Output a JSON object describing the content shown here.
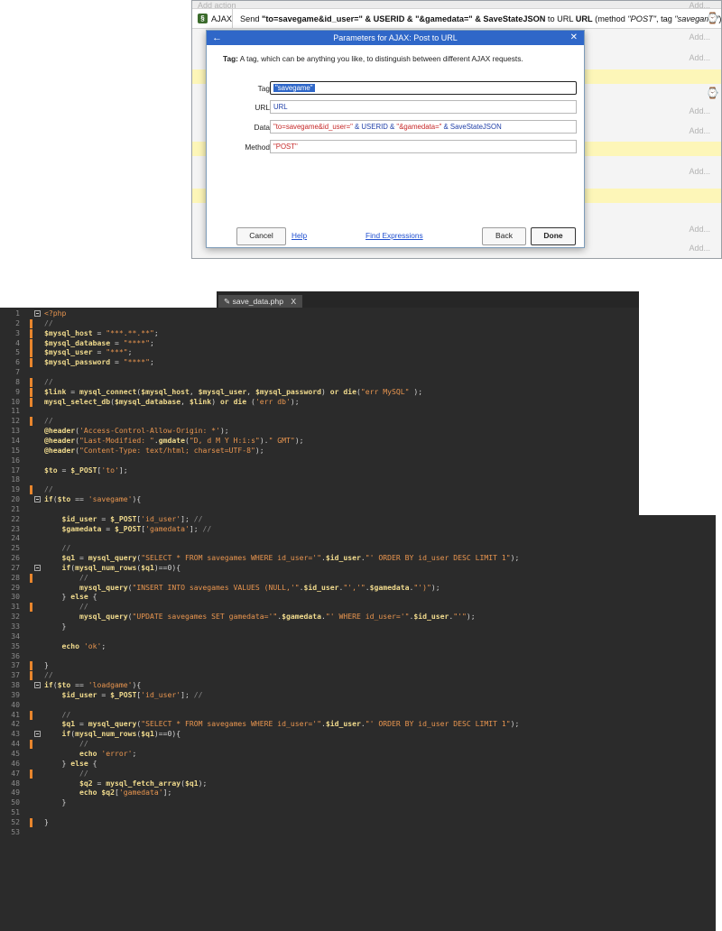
{
  "event_sheet": {
    "faded_top_label": "Add action",
    "add_label": "Add...",
    "ajax_row": {
      "object": "AJAX",
      "parts": [
        {
          "t": "Send ",
          "s": "n"
        },
        {
          "t": "\"to=savegame&id_user=\" & USERID & \"&gamedata=\" & SaveStateJSON",
          "s": "b"
        },
        {
          "t": " to URL ",
          "s": "n"
        },
        {
          "t": "URL",
          "s": "b"
        },
        {
          "t": " (method ",
          "s": "n"
        },
        {
          "t": "\"POST\"",
          "s": "i"
        },
        {
          "t": ", tag ",
          "s": "n"
        },
        {
          "t": "\"savegame\"",
          "s": "i"
        },
        {
          "t": ")",
          "s": "n"
        }
      ]
    }
  },
  "dialog": {
    "title": "Parameters for AJAX: Post to URL",
    "description_bold": "Tag:",
    "description": " A tag, which can be anything you like, to distinguish between different AJAX requests.",
    "fields": [
      {
        "label": "Tag",
        "value": "\"savegame\"",
        "style": "sel"
      },
      {
        "label": "URL",
        "value": "URL",
        "style": "blue"
      },
      {
        "label": "Data",
        "value": "",
        "style": "mixed",
        "parts": [
          {
            "t": "\"to=savegame&id_user=\"",
            "c": "red"
          },
          {
            "t": " & USERID & ",
            "c": "blue"
          },
          {
            "t": "\"&gamedata=\"",
            "c": "red"
          },
          {
            "t": " & SaveStateJSON",
            "c": "blue"
          }
        ]
      },
      {
        "label": "Method",
        "value": "\"POST\"",
        "style": "red"
      }
    ],
    "buttons": {
      "cancel": "Cancel",
      "help": "Help",
      "find": "Find Expressions",
      "back": "Back",
      "done": "Done"
    }
  },
  "editor": {
    "tab_label": "save_data.php",
    "tab_close": "X",
    "lines": [
      {
        "n": "1",
        "fold": true,
        "mark": false,
        "tokens": [
          [
            "<?php",
            "php"
          ]
        ]
      },
      {
        "n": "2",
        "mark": true,
        "tokens": [
          [
            "    //",
            "cmt"
          ]
        ]
      },
      {
        "n": "3",
        "mark": true,
        "tokens": [
          [
            "    $mysql_host",
            "var"
          ],
          [
            " = ",
            "plain"
          ],
          [
            "\"***.**.**\"",
            "str"
          ],
          [
            ";",
            "plain"
          ]
        ]
      },
      {
        "n": "4",
        "mark": true,
        "tokens": [
          [
            "    $mysql_database",
            "var"
          ],
          [
            " = ",
            "plain"
          ],
          [
            "\"****\"",
            "str"
          ],
          [
            ";",
            "plain"
          ]
        ]
      },
      {
        "n": "5",
        "mark": true,
        "tokens": [
          [
            "    $mysql_user",
            "var"
          ],
          [
            " = ",
            "plain"
          ],
          [
            "\"***\"",
            "str"
          ],
          [
            ";",
            "plain"
          ]
        ]
      },
      {
        "n": "6",
        "mark": true,
        "tokens": [
          [
            "    $mysql_password",
            "var"
          ],
          [
            " = ",
            "plain"
          ],
          [
            "\"****\"",
            "str"
          ],
          [
            ";",
            "plain"
          ]
        ]
      },
      {
        "n": "7",
        "tokens": []
      },
      {
        "n": "8",
        "mark": true,
        "tokens": [
          [
            "    //",
            "cmt"
          ]
        ]
      },
      {
        "n": "9",
        "mark": true,
        "tokens": [
          [
            "    $link",
            "var"
          ],
          [
            " = ",
            "plain"
          ],
          [
            "mysql_connect",
            "kw"
          ],
          [
            "(",
            "plain"
          ],
          [
            "$mysql_host",
            "var"
          ],
          [
            ", ",
            "plain"
          ],
          [
            "$mysql_user",
            "var"
          ],
          [
            ", ",
            "plain"
          ],
          [
            "$mysql_password",
            "var"
          ],
          [
            ") ",
            "plain"
          ],
          [
            "or",
            "kw"
          ],
          [
            " ",
            "plain"
          ],
          [
            "die",
            "kw"
          ],
          [
            "(",
            "plain"
          ],
          [
            "\"err MySQL\"",
            "str"
          ],
          [
            " );",
            "plain"
          ]
        ]
      },
      {
        "n": "10",
        "mark": true,
        "tokens": [
          [
            "    mysql_select_db",
            "kw"
          ],
          [
            "(",
            "plain"
          ],
          [
            "$mysql_database",
            "var"
          ],
          [
            ", ",
            "plain"
          ],
          [
            "$link",
            "var"
          ],
          [
            ") ",
            "plain"
          ],
          [
            "or",
            "kw"
          ],
          [
            " ",
            "plain"
          ],
          [
            "die",
            "kw"
          ],
          [
            " (",
            "plain"
          ],
          [
            "'err db'",
            "str"
          ],
          [
            ");",
            "plain"
          ]
        ]
      },
      {
        "n": "11",
        "tokens": []
      },
      {
        "n": "12",
        "mark": true,
        "tokens": [
          [
            "    //",
            "cmt"
          ]
        ]
      },
      {
        "n": "13",
        "tokens": [
          [
            "    @header",
            "kw"
          ],
          [
            "(",
            "plain"
          ],
          [
            "'Access-Control-Allow-Origin: *'",
            "str"
          ],
          [
            ");",
            "plain"
          ]
        ]
      },
      {
        "n": "14",
        "tokens": [
          [
            "    @header",
            "kw"
          ],
          [
            "(",
            "plain"
          ],
          [
            "\"Last-Modified: \"",
            "str"
          ],
          [
            ".",
            "plain"
          ],
          [
            "gmdate",
            "kw"
          ],
          [
            "(",
            "plain"
          ],
          [
            "\"D, d M Y H:i:s\"",
            "str"
          ],
          [
            ").",
            "plain"
          ],
          [
            "\" GMT\"",
            "str"
          ],
          [
            ");",
            "plain"
          ]
        ]
      },
      {
        "n": "15",
        "tokens": [
          [
            "    @header",
            "kw"
          ],
          [
            "(",
            "plain"
          ],
          [
            "\"Content-Type: text/html; charset=UTF-8\"",
            "str"
          ],
          [
            ");",
            "plain"
          ]
        ]
      },
      {
        "n": "16",
        "tokens": []
      },
      {
        "n": "17",
        "tokens": [
          [
            "    $to",
            "var"
          ],
          [
            " = ",
            "plain"
          ],
          [
            "$_POST",
            "var"
          ],
          [
            "[",
            "plain"
          ],
          [
            "'to'",
            "str"
          ],
          [
            "];",
            "plain"
          ]
        ]
      },
      {
        "n": "18",
        "tokens": []
      },
      {
        "n": "19",
        "mark": true,
        "tokens": [
          [
            "    //",
            "cmt"
          ]
        ]
      },
      {
        "n": "20",
        "fold": true,
        "tokens": [
          [
            "    if",
            "kw"
          ],
          [
            "(",
            "plain"
          ],
          [
            "$to",
            "var"
          ],
          [
            " == ",
            "plain"
          ],
          [
            "'savegame'",
            "str"
          ],
          [
            "){",
            "plain"
          ]
        ]
      },
      {
        "n": "21",
        "tokens": []
      },
      {
        "n": "22",
        "tokens": [
          [
            "        $id_user",
            "var"
          ],
          [
            " = ",
            "plain"
          ],
          [
            "$_POST",
            "var"
          ],
          [
            "[",
            "plain"
          ],
          [
            "'id_user'",
            "str"
          ],
          [
            "]; ",
            "plain"
          ],
          [
            "//",
            "cmt"
          ]
        ]
      },
      {
        "n": "23",
        "tokens": [
          [
            "        $gamedata",
            "var"
          ],
          [
            " = ",
            "plain"
          ],
          [
            "$_POST",
            "var"
          ],
          [
            "[",
            "plain"
          ],
          [
            "'gamedata'",
            "str"
          ],
          [
            "]; ",
            "plain"
          ],
          [
            "//",
            "cmt"
          ]
        ]
      },
      {
        "n": "24",
        "tokens": []
      },
      {
        "n": "25",
        "tokens": [
          [
            "        //",
            "cmt"
          ]
        ]
      },
      {
        "n": "26",
        "tokens": [
          [
            "        $q1",
            "var"
          ],
          [
            " = ",
            "plain"
          ],
          [
            "mysql_query",
            "kw"
          ],
          [
            "(",
            "plain"
          ],
          [
            "\"SELECT * FROM savegames WHERE id_user='\"",
            "str"
          ],
          [
            ".",
            "plain"
          ],
          [
            "$id_user",
            "var"
          ],
          [
            ".",
            "plain"
          ],
          [
            "\"' ORDER BY id_user DESC LIMIT 1\"",
            "str"
          ],
          [
            ");",
            "plain"
          ]
        ]
      },
      {
        "n": "27",
        "fold": true,
        "tokens": [
          [
            "        if",
            "kw"
          ],
          [
            "(",
            "plain"
          ],
          [
            "mysql_num_rows",
            "kw"
          ],
          [
            "(",
            "plain"
          ],
          [
            "$q1",
            "var"
          ],
          [
            ")==0){",
            "plain"
          ]
        ]
      },
      {
        "n": "28",
        "mark": true,
        "tokens": [
          [
            "            //",
            "cmt"
          ]
        ]
      },
      {
        "n": "29",
        "tokens": [
          [
            "            mysql_query",
            "kw"
          ],
          [
            "(",
            "plain"
          ],
          [
            "\"INSERT INTO savegames VALUES (NULL,'\"",
            "str"
          ],
          [
            ".",
            "plain"
          ],
          [
            "$id_user",
            "var"
          ],
          [
            ".",
            "plain"
          ],
          [
            "\"','\"",
            "str"
          ],
          [
            ".",
            "plain"
          ],
          [
            "$gamedata",
            "var"
          ],
          [
            ".",
            "plain"
          ],
          [
            "\"')\"",
            "str"
          ],
          [
            ");",
            "plain"
          ]
        ]
      },
      {
        "n": "30",
        "tokens": [
          [
            "        } ",
            "plain"
          ],
          [
            "else",
            "kw"
          ],
          [
            " {",
            "plain"
          ]
        ]
      },
      {
        "n": "31",
        "mark": true,
        "tokens": [
          [
            "            //",
            "cmt"
          ]
        ]
      },
      {
        "n": "32",
        "tokens": [
          [
            "            mysql_query",
            "kw"
          ],
          [
            "(",
            "plain"
          ],
          [
            "\"UPDATE savegames SET gamedata='\"",
            "str"
          ],
          [
            ".",
            "plain"
          ],
          [
            "$gamedata",
            "var"
          ],
          [
            ".",
            "plain"
          ],
          [
            "\"' WHERE id_user='\"",
            "str"
          ],
          [
            ".",
            "plain"
          ],
          [
            "$id_user",
            "var"
          ],
          [
            ".",
            "plain"
          ],
          [
            "\"'\"",
            "str"
          ],
          [
            ");",
            "plain"
          ]
        ]
      },
      {
        "n": "33",
        "tokens": [
          [
            "        }",
            "plain"
          ]
        ]
      },
      {
        "n": "34",
        "tokens": []
      },
      {
        "n": "35",
        "tokens": [
          [
            "        echo",
            "kw"
          ],
          [
            " ",
            "plain"
          ],
          [
            "'ok'",
            "str"
          ],
          [
            ";",
            "plain"
          ]
        ]
      },
      {
        "n": "36",
        "tokens": []
      },
      {
        "n": "37",
        "mark": true,
        "tokens": [
          [
            "    }",
            "plain"
          ]
        ]
      },
      {
        "n": "37",
        "mark": true,
        "tokens": [
          [
            "    //",
            "cmt"
          ]
        ]
      },
      {
        "n": "38",
        "fold": true,
        "tokens": [
          [
            "    if",
            "kw"
          ],
          [
            "(",
            "plain"
          ],
          [
            "$to",
            "var"
          ],
          [
            " == ",
            "plain"
          ],
          [
            "'loadgame'",
            "str"
          ],
          [
            "){",
            "plain"
          ]
        ]
      },
      {
        "n": "39",
        "tokens": [
          [
            "        $id_user",
            "var"
          ],
          [
            " = ",
            "plain"
          ],
          [
            "$_POST",
            "var"
          ],
          [
            "[",
            "plain"
          ],
          [
            "'id_user'",
            "str"
          ],
          [
            "]; ",
            "plain"
          ],
          [
            "//",
            "cmt"
          ]
        ]
      },
      {
        "n": "40",
        "tokens": []
      },
      {
        "n": "41",
        "mark": true,
        "tokens": [
          [
            "        //",
            "cmt"
          ]
        ]
      },
      {
        "n": "42",
        "tokens": [
          [
            "        $q1",
            "var"
          ],
          [
            " = ",
            "plain"
          ],
          [
            "mysql_query",
            "kw"
          ],
          [
            "(",
            "plain"
          ],
          [
            "\"SELECT * FROM savegames WHERE id_user='\"",
            "str"
          ],
          [
            ".",
            "plain"
          ],
          [
            "$id_user",
            "var"
          ],
          [
            ".",
            "plain"
          ],
          [
            "\"' ORDER BY id_user DESC LIMIT 1\"",
            "str"
          ],
          [
            ");",
            "plain"
          ]
        ]
      },
      {
        "n": "43",
        "fold": true,
        "tokens": [
          [
            "        if",
            "kw"
          ],
          [
            "(",
            "plain"
          ],
          [
            "mysql_num_rows",
            "kw"
          ],
          [
            "(",
            "plain"
          ],
          [
            "$q1",
            "var"
          ],
          [
            ")==0){",
            "plain"
          ]
        ]
      },
      {
        "n": "44",
        "mark": true,
        "tokens": [
          [
            "            //",
            "cmt"
          ]
        ]
      },
      {
        "n": "45",
        "tokens": [
          [
            "            echo",
            "kw"
          ],
          [
            " ",
            "plain"
          ],
          [
            "'error'",
            "str"
          ],
          [
            ";",
            "plain"
          ]
        ]
      },
      {
        "n": "46",
        "tokens": [
          [
            "        } ",
            "plain"
          ],
          [
            "else",
            "kw"
          ],
          [
            " {",
            "plain"
          ]
        ]
      },
      {
        "n": "47",
        "mark": true,
        "tokens": [
          [
            "            //",
            "cmt"
          ]
        ]
      },
      {
        "n": "48",
        "tokens": [
          [
            "            $q2",
            "var"
          ],
          [
            " = ",
            "plain"
          ],
          [
            "mysql_fetch_array",
            "kw"
          ],
          [
            "(",
            "plain"
          ],
          [
            "$q1",
            "var"
          ],
          [
            ");",
            "plain"
          ]
        ]
      },
      {
        "n": "49",
        "tokens": [
          [
            "            echo",
            "kw"
          ],
          [
            " ",
            "plain"
          ],
          [
            "$q2",
            "var"
          ],
          [
            "[",
            "plain"
          ],
          [
            "'gamedata'",
            "str"
          ],
          [
            "];",
            "plain"
          ]
        ]
      },
      {
        "n": "50",
        "tokens": [
          [
            "        }",
            "plain"
          ]
        ]
      },
      {
        "n": "51",
        "tokens": []
      },
      {
        "n": "52",
        "mark": true,
        "tokens": [
          [
            "    }",
            "plain"
          ]
        ]
      },
      {
        "n": "53",
        "tokens": []
      }
    ]
  },
  "colors": {
    "dialog_title_bg": "#2f67c8",
    "editor_bg": "#2b2b2b",
    "change_marker": "#e8852d",
    "highlight_row": "#fdf6b8"
  }
}
